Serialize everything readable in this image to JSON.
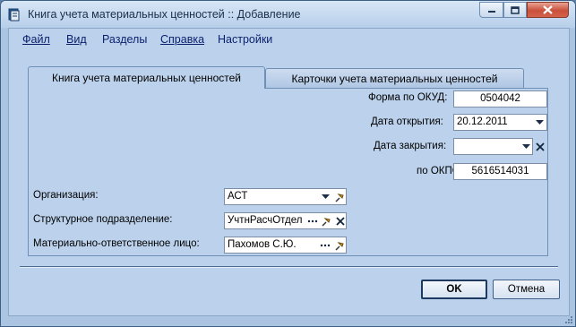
{
  "window": {
    "title": "Книга учета материальных ценностей :: Добавление"
  },
  "menu": [
    "Файл",
    "Вид",
    "Разделы",
    "Справка",
    "Настройки"
  ],
  "tabs": [
    {
      "label": "Книга учета материальных ценностей",
      "active": true
    },
    {
      "label": "Карточки учета материальных ценностей",
      "active": false
    }
  ],
  "form": {
    "okud_label": "Форма по ОКУД:",
    "okud_value": "0504042",
    "open_date_label": "Дата открытия:",
    "open_date_value": "20.12.2011",
    "close_date_label": "Дата закрытия:",
    "close_date_value": "",
    "okpo_label": "по ОКПО:",
    "okpo_value": "5616514031",
    "org_label": "Организация:",
    "org_value": "АСТ",
    "subdiv_label": "Структурное подразделение:",
    "subdiv_value": "УчтнРасчОтдел",
    "person_label": "Материально-ответственное лицо:",
    "person_value": "Пахомов С.Ю."
  },
  "buttons": {
    "ok": "OK",
    "cancel": "Отмена"
  },
  "colors": {
    "accent": "#0a1f6b",
    "close_button": "#c9503b"
  }
}
